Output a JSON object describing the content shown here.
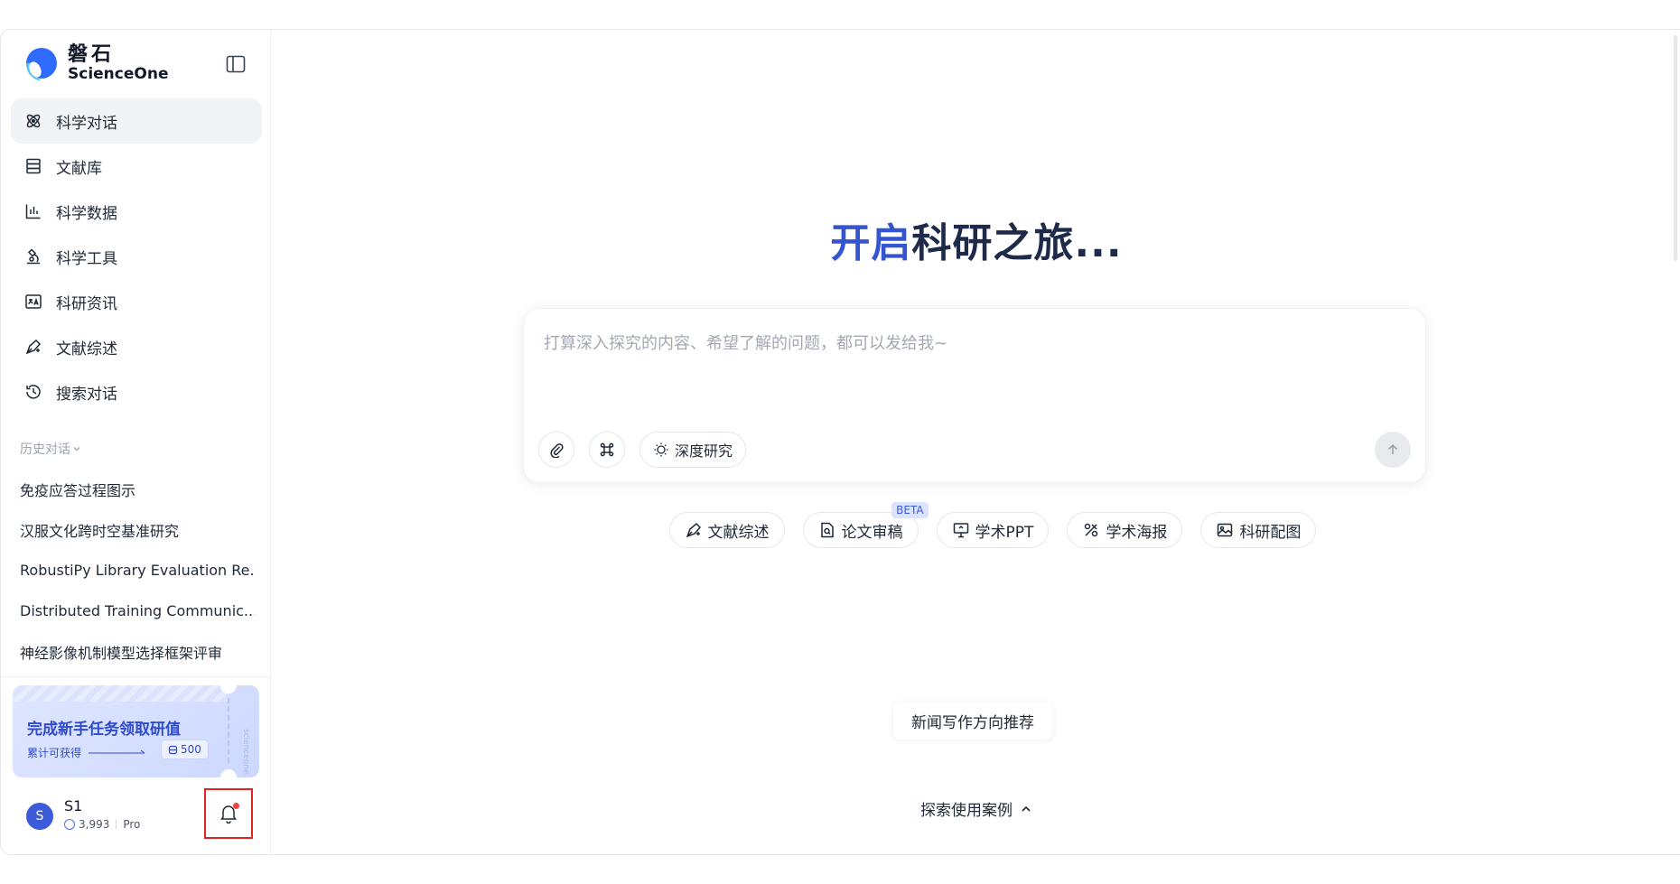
{
  "brand": {
    "name_cn": "磐石",
    "name_en": "ScienceOne"
  },
  "sidebar": {
    "nav_items": [
      {
        "label": "科学对话",
        "icon": "atom-icon",
        "active": true
      },
      {
        "label": "文献库",
        "icon": "database-icon",
        "active": false
      },
      {
        "label": "科学数据",
        "icon": "bar-chart-icon",
        "active": false
      },
      {
        "label": "科学工具",
        "icon": "microscope-icon",
        "active": false
      },
      {
        "label": "科研资讯",
        "icon": "translate-icon",
        "active": false
      },
      {
        "label": "文献综述",
        "icon": "pen-nib-icon",
        "active": false
      },
      {
        "label": "搜索对话",
        "icon": "history-icon",
        "active": false
      }
    ],
    "history_label": "历史对话",
    "history_items": [
      "免疫应答过程图示",
      "汉服文化跨时空基准研究",
      "RobustiPy Library Evaluation Re...",
      "Distributed Training Communic...",
      "神经影像机制模型选择框架评审"
    ],
    "promo": {
      "title": "完成新手任务领取研值",
      "subtitle": "累计可获得",
      "reward": "500",
      "side_text": "scienceone.ai"
    },
    "user": {
      "avatar_initial": "S",
      "name": "S1",
      "credits": "3,993",
      "plan": "Pro"
    }
  },
  "main": {
    "hero_accent": "开启",
    "hero_rest": "科研之旅...",
    "input_placeholder": "打算深入探究的内容、希望了解的问题，都可以发给我~",
    "deep_research_label": "深度研究",
    "quick_actions": [
      {
        "label": "文献综述",
        "icon": "pen-nib-icon",
        "badge": ""
      },
      {
        "label": "论文审稿",
        "icon": "doc-search-icon",
        "badge": "BETA"
      },
      {
        "label": "学术PPT",
        "icon": "presentation-icon",
        "badge": ""
      },
      {
        "label": "学术海报",
        "icon": "poster-icon",
        "badge": ""
      },
      {
        "label": "科研配图",
        "icon": "image-icon",
        "badge": ""
      }
    ],
    "suggestion": "新闻写作方向推荐",
    "explore_label": "探索使用案例"
  },
  "colors": {
    "accent": "#3454d1",
    "hero_text": "#1e2a4a",
    "notification_highlight": "#e02424"
  }
}
